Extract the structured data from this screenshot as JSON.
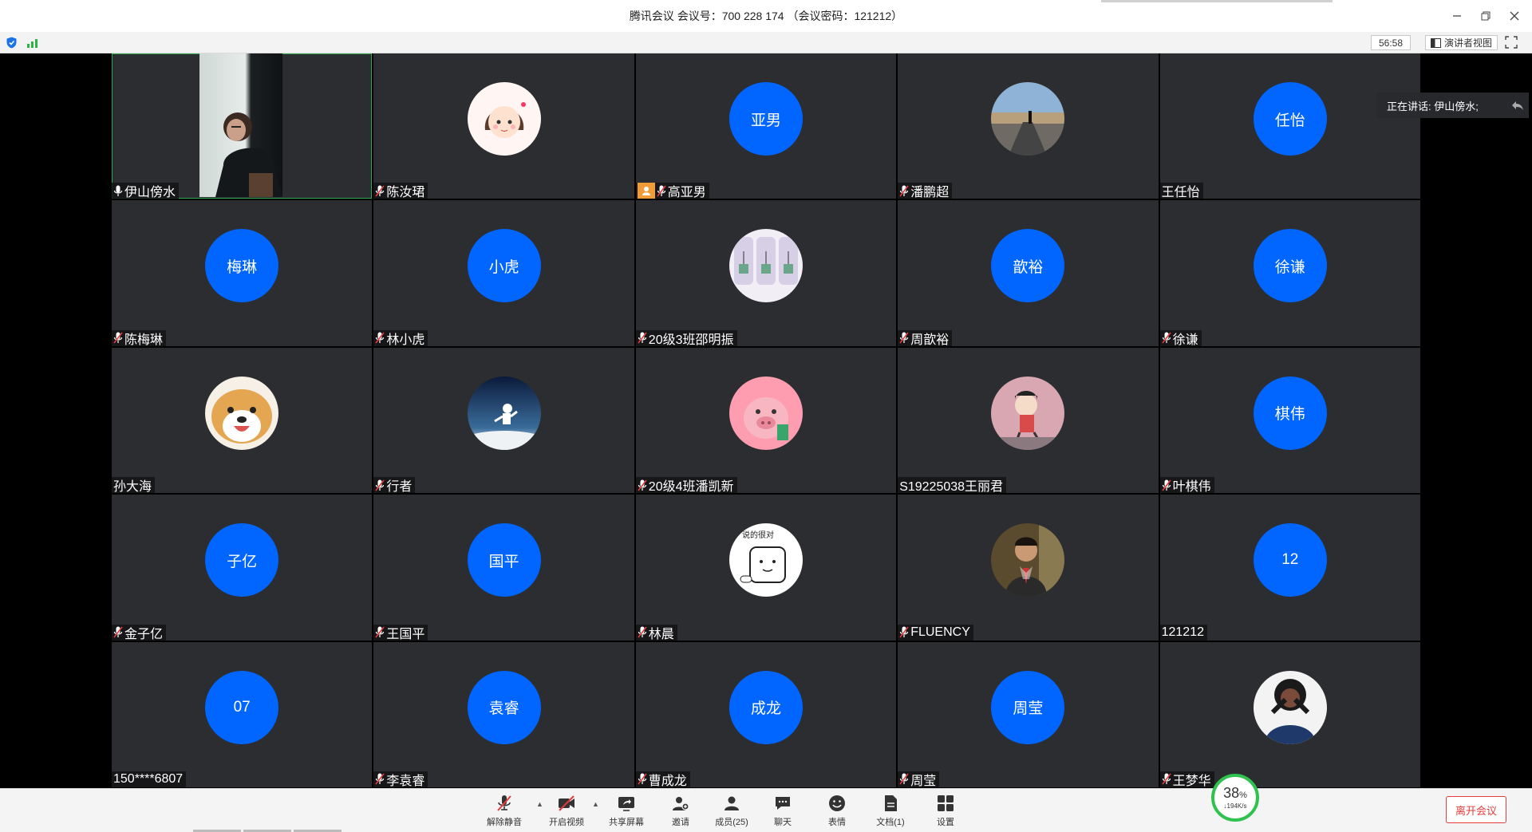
{
  "window": {
    "title": "腾讯会议 会议号：700 228 174 （会议密码：121212）"
  },
  "statusbar": {
    "timer": "56:58",
    "speaker_view_label": "演讲者视图"
  },
  "speaking_label": "正在讲话: 伊山傍水;",
  "participants": [
    {
      "name": "伊山傍水",
      "avatar_type": "video",
      "mic": "on"
    },
    {
      "name": "陈汝珺",
      "avatar_type": "photo-cartoon-girl",
      "mic": "muted"
    },
    {
      "name": "高亚男",
      "avatar_type": "text",
      "avatar_text": "亚男",
      "mic": "muted",
      "host": true
    },
    {
      "name": "潘鹏超",
      "avatar_type": "photo-road",
      "mic": "muted"
    },
    {
      "name": "王任怡",
      "avatar_type": "text",
      "avatar_text": "任怡",
      "mic": "none"
    },
    {
      "name": "陈梅琳",
      "avatar_type": "text",
      "avatar_text": "梅琳",
      "mic": "muted"
    },
    {
      "name": "林小虎",
      "avatar_type": "text",
      "avatar_text": "小虎",
      "mic": "muted"
    },
    {
      "name": "20级3班邵明振",
      "avatar_type": "photo-plants",
      "mic": "muted"
    },
    {
      "name": "周歆裕",
      "avatar_type": "text",
      "avatar_text": "歆裕",
      "mic": "muted"
    },
    {
      "name": "徐谦",
      "avatar_type": "text",
      "avatar_text": "徐谦",
      "mic": "muted"
    },
    {
      "name": "孙大海",
      "avatar_type": "photo-dog",
      "mic": "none"
    },
    {
      "name": "行者",
      "avatar_type": "photo-astronaut",
      "mic": "muted"
    },
    {
      "name": "20级4班潘凯新",
      "avatar_type": "photo-pig",
      "mic": "muted"
    },
    {
      "name": "S19225038王丽君",
      "avatar_type": "photo-anime",
      "mic": "none"
    },
    {
      "name": "叶棋伟",
      "avatar_type": "text",
      "avatar_text": "棋伟",
      "mic": "muted"
    },
    {
      "name": "金子亿",
      "avatar_type": "text",
      "avatar_text": "子亿",
      "mic": "muted"
    },
    {
      "name": "王国平",
      "avatar_type": "text",
      "avatar_text": "国平",
      "mic": "muted"
    },
    {
      "name": "林晨",
      "avatar_type": "photo-sketch",
      "mic": "muted"
    },
    {
      "name": "FLUENCY",
      "avatar_type": "photo-man",
      "mic": "muted"
    },
    {
      "name": "121212",
      "avatar_type": "text",
      "avatar_text": "12",
      "mic": "none"
    },
    {
      "name": "150****6807",
      "avatar_type": "text",
      "avatar_text": "07",
      "mic": "none"
    },
    {
      "name": "李袁睿",
      "avatar_type": "text",
      "avatar_text": "袁睿",
      "mic": "muted"
    },
    {
      "name": "曹成龙",
      "avatar_type": "text",
      "avatar_text": "成龙",
      "mic": "muted"
    },
    {
      "name": "周莹",
      "avatar_type": "text",
      "avatar_text": "周莹",
      "mic": "muted"
    },
    {
      "name": "王梦华",
      "avatar_type": "photo-person",
      "mic": "muted"
    }
  ],
  "sketch_avatar_text": "说的很对",
  "toolbar": {
    "unmute": "解除静音",
    "start_video": "开启视频",
    "share_screen": "共享屏幕",
    "invite": "邀请",
    "members": "成员(25)",
    "chat": "聊天",
    "reactions": "表情",
    "docs": "文档(1)",
    "settings": "设置",
    "leave": "离开会议"
  },
  "network": {
    "percent": "38",
    "percent_unit": "%",
    "speed": "↓194K/s"
  },
  "colors": {
    "avatar_blue": "#0066ff",
    "tile_bg": "#2b2d30",
    "leave_red": "#e43c3c",
    "network_green": "#2fc24f"
  }
}
